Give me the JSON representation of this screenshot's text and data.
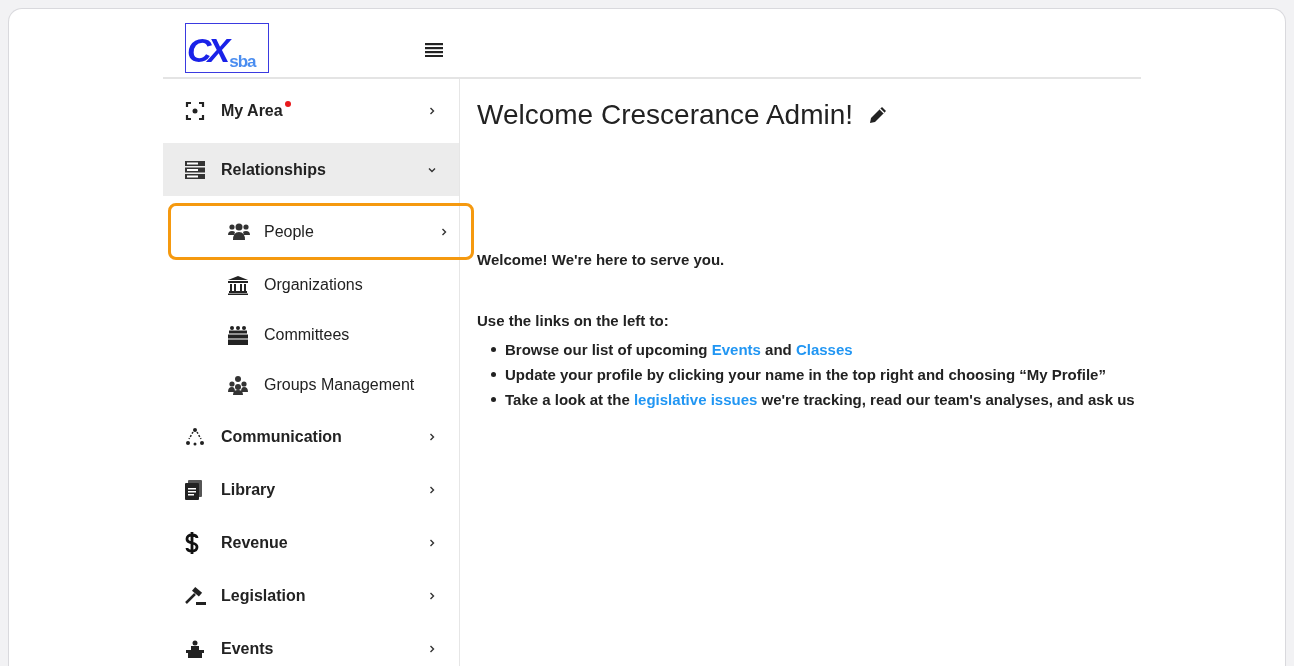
{
  "logo": {
    "main": "CX",
    "sub": "sba"
  },
  "sidebar": {
    "items": [
      {
        "label": "My Area",
        "notification": true,
        "expanded": false,
        "selected": false
      },
      {
        "label": "Relationships",
        "notification": false,
        "expanded": true,
        "selected": true,
        "children": [
          {
            "label": "People",
            "highlighted": true,
            "chevron": true
          },
          {
            "label": "Organizations",
            "highlighted": false,
            "chevron": false
          },
          {
            "label": "Committees",
            "highlighted": false,
            "chevron": false
          },
          {
            "label": "Groups Management",
            "highlighted": false,
            "chevron": false
          }
        ]
      },
      {
        "label": "Communication",
        "notification": false,
        "expanded": false,
        "selected": false
      },
      {
        "label": "Library",
        "notification": false,
        "expanded": false,
        "selected": false
      },
      {
        "label": "Revenue",
        "notification": false,
        "expanded": false,
        "selected": false
      },
      {
        "label": "Legislation",
        "notification": false,
        "expanded": false,
        "selected": false
      },
      {
        "label": "Events",
        "notification": false,
        "expanded": false,
        "selected": false
      }
    ]
  },
  "content": {
    "heading": "Welcome Crescerance Admin!",
    "intro": "Welcome!  We're here to serve you.",
    "lead": "Use the links on the left to:",
    "bullets": [
      [
        {
          "kind": "text",
          "text": "Browse our list of upcoming "
        },
        {
          "kind": "link",
          "text": "Events"
        },
        {
          "kind": "text",
          "text": " and "
        },
        {
          "kind": "link",
          "text": "Classes"
        }
      ],
      [
        {
          "kind": "text",
          "text": "Update your profile by clicking your name in the top right and choosing “My Profile”"
        }
      ],
      [
        {
          "kind": "text",
          "text": "Take a look at the "
        },
        {
          "kind": "link",
          "text": "legislative issues"
        },
        {
          "kind": "text",
          "text": " we're tracking, read our team's analyses, and ask us"
        }
      ]
    ]
  }
}
